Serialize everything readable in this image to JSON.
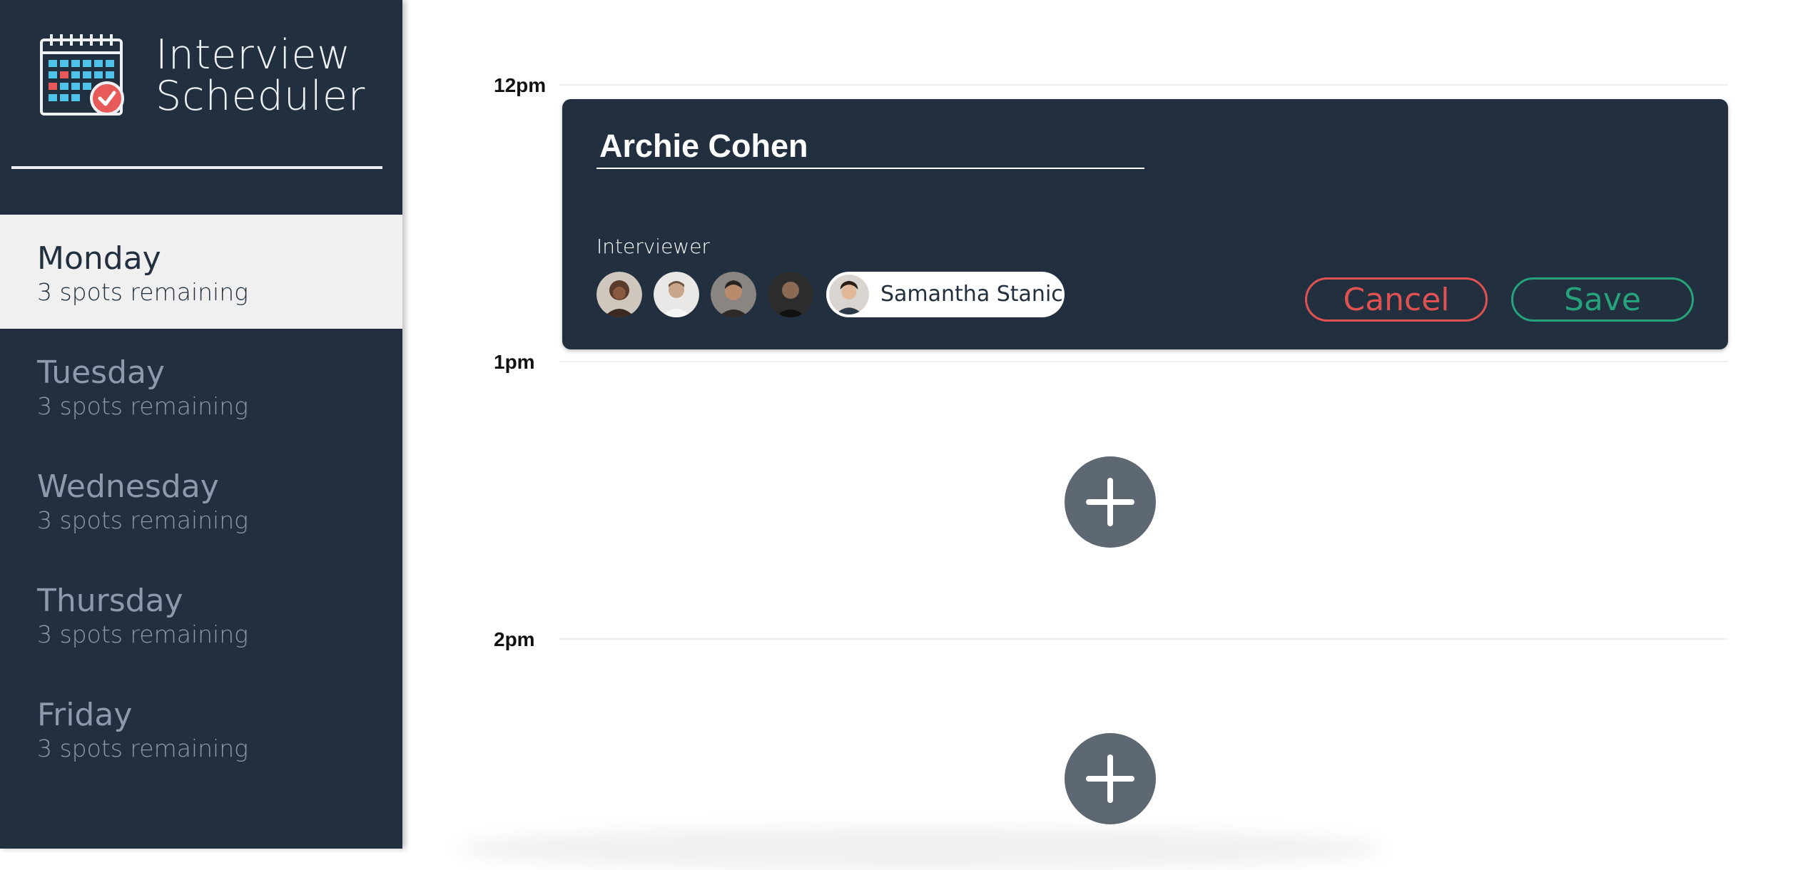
{
  "sidebar": {
    "brand": {
      "line1": "Interview",
      "line2": "Scheduler",
      "logo_icon": "calendar-check-icon"
    },
    "days": [
      {
        "name": "Monday",
        "spots": "3 spots remaining",
        "selected": true
      },
      {
        "name": "Tuesday",
        "spots": "3 spots remaining",
        "selected": false
      },
      {
        "name": "Wednesday",
        "spots": "3 spots remaining",
        "selected": false
      },
      {
        "name": "Thursday",
        "spots": "3 spots remaining",
        "selected": false
      },
      {
        "name": "Friday",
        "spots": "3 spots remaining",
        "selected": false
      }
    ]
  },
  "schedule": {
    "times": [
      "12pm",
      "1pm",
      "2pm"
    ],
    "form": {
      "student_name": "Archie Cohen",
      "interviewer_heading": "Interviewer",
      "selected_interviewer": "Samantha Stanic",
      "cancel_label": "Cancel",
      "save_label": "Save"
    },
    "add_icon": "plus-icon"
  },
  "colors": {
    "sidebar_bg": "#222f3e",
    "cancel": "#e05252",
    "save": "#27a37b",
    "add_button": "#5e6873"
  }
}
